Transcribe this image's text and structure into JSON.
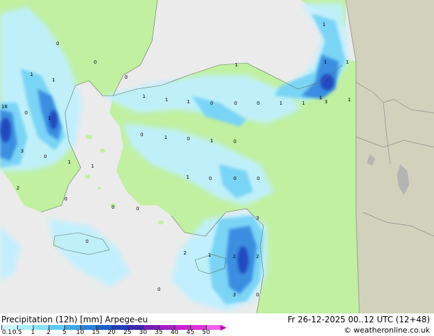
{
  "legend": {
    "title": "Precipitation (12h) [mm] Arpege-eu",
    "time": "Fr 26-12-2025 00..12 UTC (12+48)",
    "credit": "© weatheronline.co.uk",
    "scale_ticks": [
      "0.1",
      "0.5",
      "1",
      "2",
      "5",
      "10",
      "15",
      "20",
      "25",
      "30",
      "35",
      "40",
      "45",
      "50"
    ],
    "scale_colors": [
      "#ccf5ff",
      "#aaeeff",
      "#88e0ff",
      "#5cc8f5",
      "#3ba8ea",
      "#2a82db",
      "#1c5fc8",
      "#1f3fb8",
      "#3a2ab0",
      "#7a1fb8",
      "#a41ec4",
      "#cc1fd0",
      "#e030d8",
      "#f060e8"
    ]
  },
  "colors": {
    "sea": "#ebebeb",
    "land": "#c0f0a0",
    "outside_domain": "#d2d2bc",
    "rain_light": "#bff0ff",
    "rain_moderate": "#7ad4f5",
    "rain_heavy": "#3a8ee0",
    "rain_very_heavy": "#2248c0"
  },
  "map_values": [
    {
      "text": "0"
    },
    {
      "text": "1"
    },
    {
      "text": "1"
    },
    {
      "text": "1"
    },
    {
      "text": "1"
    },
    {
      "text": "1"
    },
    {
      "text": "18"
    },
    {
      "text": "0"
    },
    {
      "text": "1"
    },
    {
      "text": "3"
    },
    {
      "text": "0"
    },
    {
      "text": "1"
    },
    {
      "text": "1"
    },
    {
      "text": "2"
    },
    {
      "text": "0"
    },
    {
      "text": "0"
    },
    {
      "text": "0"
    },
    {
      "text": "1"
    },
    {
      "text": "1"
    },
    {
      "text": "0"
    },
    {
      "text": "1"
    },
    {
      "text": "0"
    },
    {
      "text": "0"
    },
    {
      "text": "1"
    },
    {
      "text": "1"
    },
    {
      "text": "1"
    },
    {
      "text": "3"
    },
    {
      "text": "1"
    },
    {
      "text": "1"
    },
    {
      "text": "1"
    },
    {
      "text": "1"
    },
    {
      "text": "0"
    },
    {
      "text": "0"
    },
    {
      "text": "0"
    },
    {
      "text": "0"
    },
    {
      "text": "1"
    },
    {
      "text": "0"
    },
    {
      "text": "0"
    },
    {
      "text": "0"
    },
    {
      "text": "0"
    },
    {
      "text": "3"
    },
    {
      "text": "2"
    },
    {
      "text": "1"
    },
    {
      "text": "2"
    },
    {
      "text": "2"
    },
    {
      "text": "3"
    },
    {
      "text": "0"
    },
    {
      "text": "0"
    },
    {
      "text": "0"
    }
  ]
}
